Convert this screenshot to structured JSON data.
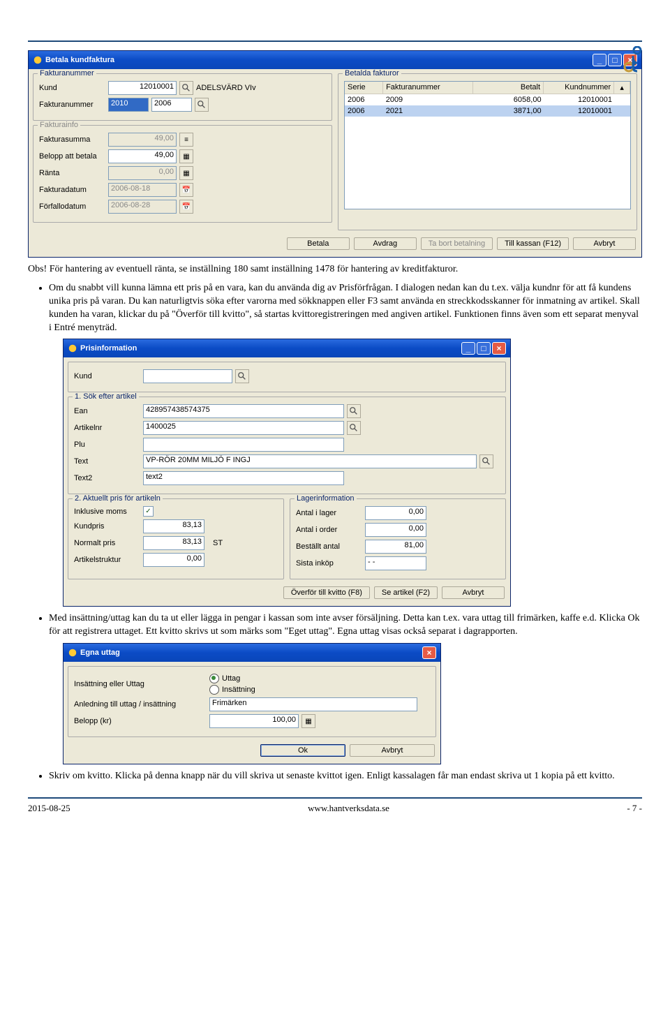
{
  "dlg1": {
    "title": "Betala kundfaktura",
    "grp_fnr": "Fakturanummer",
    "grp_finfo": "Fakturainfo",
    "grp_paid": "Betalda fakturor",
    "lbl_kund": "Kund",
    "lbl_fnr": "Fakturanummer",
    "lbl_fsum": "Fakturasumma",
    "lbl_belopp": "Belopp att betala",
    "lbl_ranta": "Ränta",
    "lbl_fdatum": "Fakturadatum",
    "lbl_ffdatum": "Förfallodatum",
    "val_kund": "12010001",
    "val_kundname": "ADELSVÄRD VIv",
    "val_fnr1": "2010",
    "val_fnr2": "2006",
    "val_fsum": "49,00",
    "val_belopp": "49,00",
    "val_ranta": "0,00",
    "val_fdatum": "2006-08-18",
    "val_ffdatum": "2006-08-28",
    "col_serie": "Serie",
    "col_fnr": "Fakturanummer",
    "col_betalt": "Betalt",
    "col_knr": "Kundnummer",
    "rows": [
      {
        "s": "2006",
        "f": "2009",
        "b": "6058,00",
        "k": "12010001"
      },
      {
        "s": "2006",
        "f": "2021",
        "b": "3871,00",
        "k": "12010001"
      }
    ],
    "btn_betala": "Betala",
    "btn_avdrag": "Avdrag",
    "btn_tabort": "Ta bort betalning",
    "btn_kassan": "Till kassan (F12)",
    "btn_avbryt": "Avbryt"
  },
  "para1": "Obs! För hantering av eventuell ränta, se inställning 180 samt inställning 1478 för hantering av kreditfakturor.",
  "bullet1": "Om du snabbt vill kunna lämna ett pris på en vara, kan du använda dig av Prisförfrågan. I dialogen nedan kan du t.ex. välja kundnr för att få kundens unika pris på varan. Du kan naturligtvis söka efter varorna med sökknappen eller F3 samt använda en streckkodsskanner för inmatning av artikel. Skall kunden ha varan, klickar du på \"Överför till kvitto\", så startas kvittoregistreringen med angiven artikel. Funktionen finns även som ett separat menyval i Entré menyträd.",
  "dlg2": {
    "title": "Prisinformation",
    "lbl_kund": "Kund",
    "grp1": "1. Sök efter artikel",
    "lbl_ean": "Ean",
    "lbl_anr": "Artikelnr",
    "lbl_plu": "Plu",
    "lbl_text": "Text",
    "lbl_text2": "Text2",
    "val_ean": "428957438574375",
    "val_anr": "1400025",
    "val_text": "VP-RÖR 20MM MILJÖ F INGJ",
    "val_text2": "text2",
    "grp2": "2. Aktuellt pris för artikeln",
    "grp3": "Lagerinformation",
    "lbl_moms": "Inklusive moms",
    "lbl_kpris": "Kundpris",
    "lbl_npris": "Normalt pris",
    "lbl_astr": "Artikelstruktur",
    "lbl_lager": "Antal i lager",
    "lbl_order": "Antal i order",
    "lbl_best": "Beställt antal",
    "lbl_sista": "Sista inköp",
    "val_kpris": "83,13",
    "val_npris": "83,13",
    "val_unit": "ST",
    "val_astr": "0,00",
    "val_lager": "0,00",
    "val_order": "0,00",
    "val_best": "81,00",
    "val_sista": "- -",
    "btn_overfor": "Överför till kvitto (F8)",
    "btn_se": "Se artikel (F2)",
    "btn_avbryt": "Avbryt"
  },
  "bullet2": "Med insättning/uttag kan du ta ut eller lägga in pengar i kassan som inte avser försäljning. Detta kan t.ex. vara uttag till frimärken, kaffe e.d. Klicka Ok för att registrera uttaget. Ett kvitto skrivs ut som märks som \"Eget uttag\". Egna uttag visas också separat i dagrapporten.",
  "dlg3": {
    "title": "Egna uttag",
    "lbl_type": "Insättning eller Uttag",
    "opt_ut": "Uttag",
    "opt_in": "Insättning",
    "lbl_anl": "Anledning till uttag / insättning",
    "lbl_bel": "Belopp (kr)",
    "val_anl": "Frimärken",
    "val_bel": "100,00",
    "btn_ok": "Ok",
    "btn_avbryt": "Avbryt"
  },
  "bullet3": "Skriv om kvitto. Klicka på denna knapp när du vill skriva ut senaste kvittot igen. Enligt kassalagen får man endast skriva ut 1 kopia på ett kvitto.",
  "footer": {
    "date": "2015-08-25",
    "url": "www.hantverksdata.se",
    "page": "- 7 -"
  }
}
